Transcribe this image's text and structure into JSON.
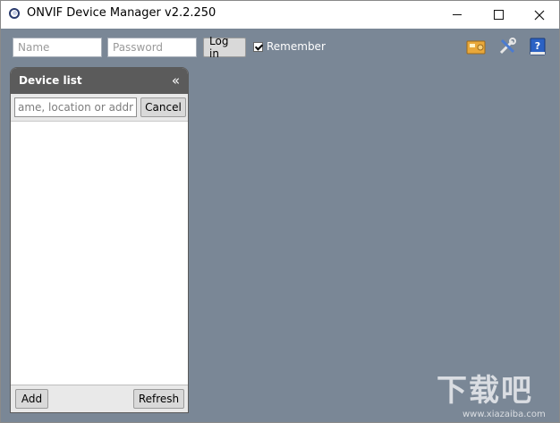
{
  "window": {
    "title": "ONVIF Device Manager v2.2.250"
  },
  "login": {
    "name_placeholder": "Name",
    "password_placeholder": "Password",
    "login_label": "Log in",
    "remember_label": "Remember",
    "remember_checked": true
  },
  "toolbar_icons": [
    "camera-card-icon",
    "tools-icon",
    "help-book-icon"
  ],
  "device_panel": {
    "title": "Device list",
    "collapse_glyph": "«",
    "search_placeholder": "ame, location or address",
    "cancel_label": "Cancel",
    "add_label": "Add",
    "refresh_label": "Refresh",
    "items": []
  },
  "watermark": {
    "text": "下载吧",
    "subtext": "www.xiazaiba.com"
  },
  "colors": {
    "client_background": "#7a8796",
    "panel_header": "#5b5b5b",
    "button_background": "#d9d9d9"
  }
}
